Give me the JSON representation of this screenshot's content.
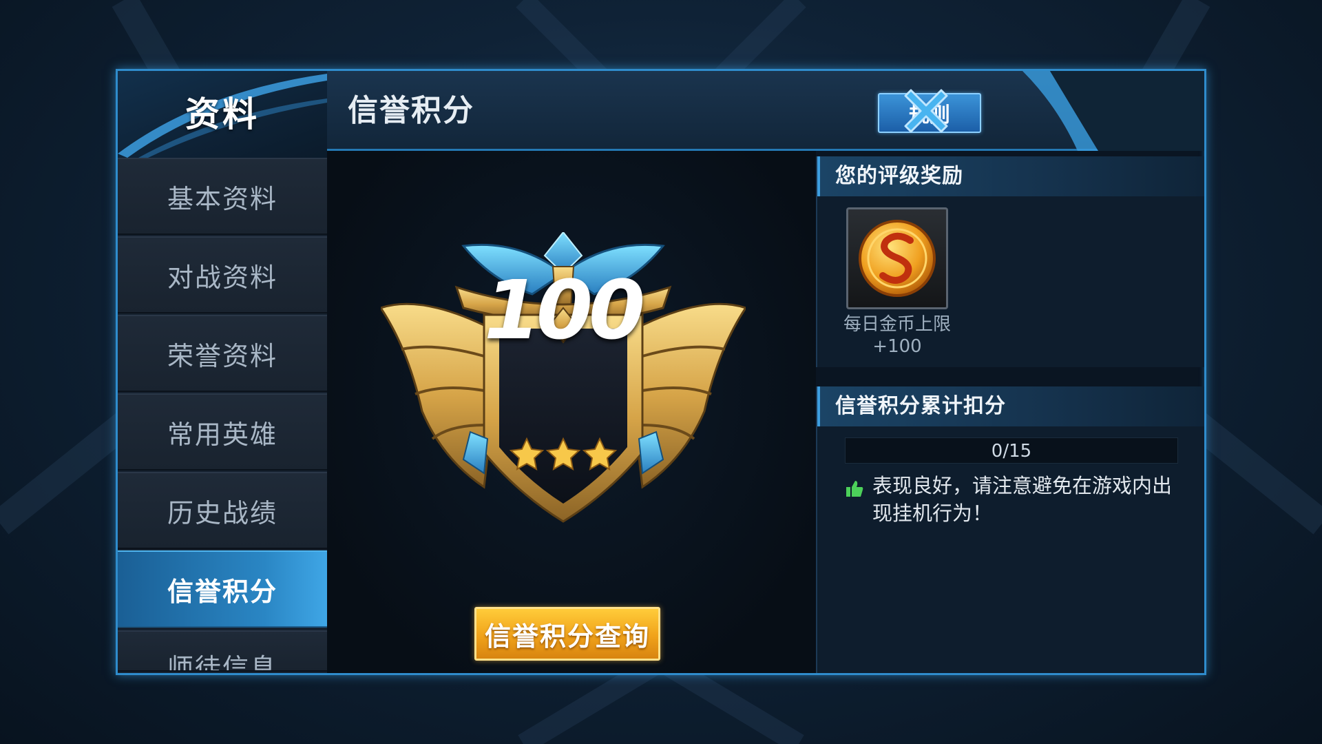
{
  "sidebar": {
    "title": "资料",
    "items": [
      {
        "label": "基本资料",
        "active": false
      },
      {
        "label": "对战资料",
        "active": false
      },
      {
        "label": "荣誉资料",
        "active": false
      },
      {
        "label": "常用英雄",
        "active": false
      },
      {
        "label": "历史战绩",
        "active": false
      },
      {
        "label": "信誉积分",
        "active": true
      },
      {
        "label": "师徒信息",
        "active": false
      }
    ]
  },
  "header": {
    "title": "信誉积分",
    "rule_label": "规则",
    "close_icon": "close-x-icon"
  },
  "emblem": {
    "score": "100",
    "stars": 3,
    "query_label": "信誉积分查询"
  },
  "reward_panel": {
    "title": "您的评级奖励",
    "reward_icon": "gold-coin-icon",
    "reward_name": "每日金币上限",
    "reward_value": "+100"
  },
  "deduction_panel": {
    "title": "信誉积分累计扣分",
    "progress_text": "0/15",
    "progress_value": 0,
    "progress_max": 15,
    "hint_icon": "thumbs-up-icon",
    "hint_text": "表现良好，请注意避免在游戏内出现挂机行为！"
  },
  "colors": {
    "accent": "#2f8ccc",
    "active_tab": "#2a86c4",
    "gold": "#f0a21a",
    "thumb": "#4cd05a"
  }
}
